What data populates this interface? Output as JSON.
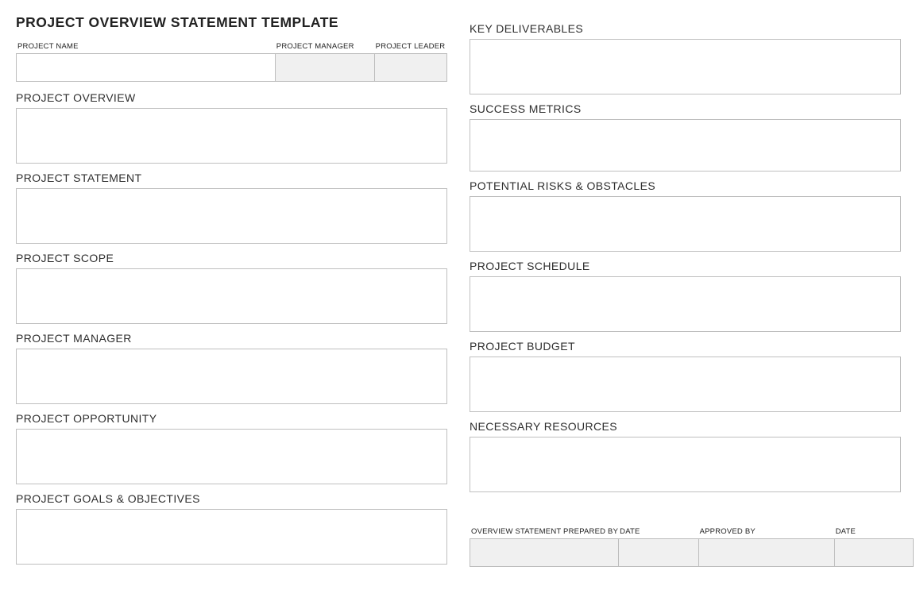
{
  "title": "PROJECT OVERVIEW STATEMENT TEMPLATE",
  "header": {
    "project_name_label": "PROJECT NAME",
    "project_manager_label": "PROJECT MANAGER",
    "project_leader_label": "PROJECT LEADER",
    "project_name_value": "",
    "project_manager_value": "",
    "project_leader_value": ""
  },
  "left_sections": [
    {
      "label": "PROJECT OVERVIEW",
      "value": ""
    },
    {
      "label": "PROJECT STATEMENT",
      "value": ""
    },
    {
      "label": "PROJECT SCOPE",
      "value": ""
    },
    {
      "label": "PROJECT MANAGER",
      "value": ""
    },
    {
      "label": "PROJECT OPPORTUNITY",
      "value": ""
    },
    {
      "label": "PROJECT GOALS & OBJECTIVES",
      "value": ""
    }
  ],
  "right_sections": [
    {
      "label": "KEY DELIVERABLES",
      "value": ""
    },
    {
      "label": "SUCCESS METRICS",
      "value": ""
    },
    {
      "label": "POTENTIAL RISKS & OBSTACLES",
      "value": ""
    },
    {
      "label": "PROJECT SCHEDULE",
      "value": ""
    },
    {
      "label": "PROJECT BUDGET",
      "value": ""
    },
    {
      "label": "NECESSARY RESOURCES",
      "value": ""
    }
  ],
  "footer": {
    "prepared_by_label": "OVERVIEW STATEMENT PREPARED BY",
    "date1_label": "DATE",
    "approved_by_label": "APPROVED BY",
    "date2_label": "DATE",
    "prepared_by_value": "",
    "date1_value": "",
    "approved_by_value": "",
    "date2_value": ""
  }
}
